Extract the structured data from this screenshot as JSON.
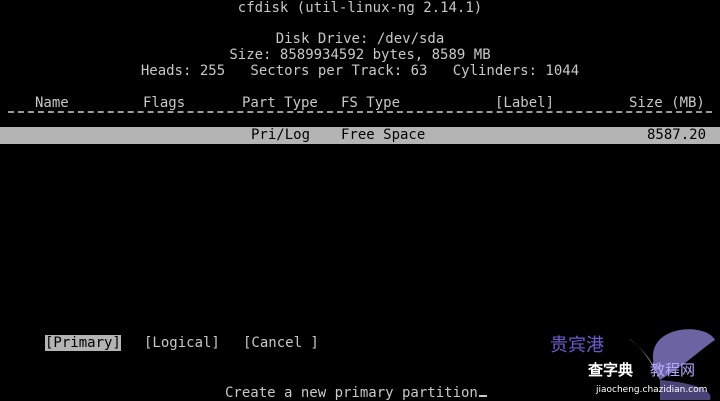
{
  "app_title": "cfdisk (util-linux-ng 2.14.1)",
  "disk": {
    "drive": "Disk Drive: /dev/sda",
    "size": "Size: 8589934592 bytes, 8589 MB",
    "geometry": "Heads: 255   Sectors per Track: 63   Cylinders: 1044"
  },
  "table": {
    "headers": {
      "name": "Name",
      "flags": "Flags",
      "part_type": "Part Type",
      "fs_type": "FS Type",
      "label": "[Label]",
      "size": "Size (MB)"
    },
    "rows": [
      {
        "name": "",
        "flags": "",
        "part_type": "Pri/Log",
        "fs_type": "Free Space",
        "label": "",
        "size": "8587.20"
      }
    ]
  },
  "menu": {
    "items": [
      {
        "label": "[Primary]",
        "selected": true
      },
      {
        "label": "[Logical]",
        "selected": false
      },
      {
        "label": "[Cancel ]",
        "selected": false
      }
    ]
  },
  "prompt": "Create a new primary partition",
  "watermark": {
    "brand": "贵宾港",
    "name_left": "查字典",
    "name_right": "教程网",
    "url": "jiaocheng.chazidian.com"
  },
  "colors": {
    "background": "#000000",
    "foreground": "#c8c8c8",
    "highlight": "#b4b4b4"
  }
}
